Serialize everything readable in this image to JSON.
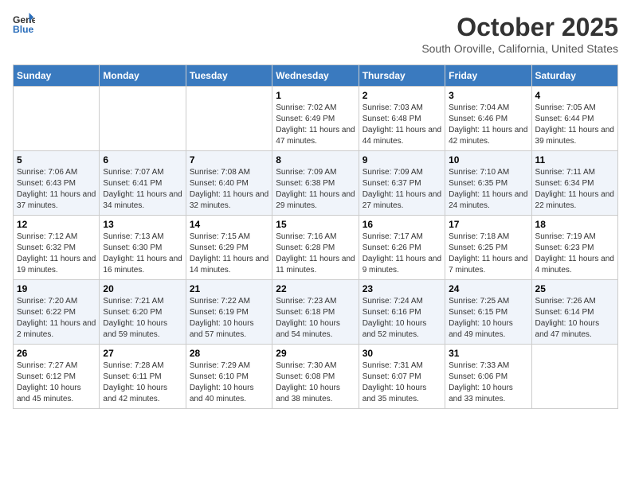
{
  "header": {
    "logo_line1": "General",
    "logo_line2": "Blue",
    "month_title": "October 2025",
    "location": "South Oroville, California, United States"
  },
  "weekdays": [
    "Sunday",
    "Monday",
    "Tuesday",
    "Wednesday",
    "Thursday",
    "Friday",
    "Saturday"
  ],
  "weeks": [
    [
      {
        "day": "",
        "sunrise": "",
        "sunset": "",
        "daylight": ""
      },
      {
        "day": "",
        "sunrise": "",
        "sunset": "",
        "daylight": ""
      },
      {
        "day": "",
        "sunrise": "",
        "sunset": "",
        "daylight": ""
      },
      {
        "day": "1",
        "sunrise": "Sunrise: 7:02 AM",
        "sunset": "Sunset: 6:49 PM",
        "daylight": "Daylight: 11 hours and 47 minutes."
      },
      {
        "day": "2",
        "sunrise": "Sunrise: 7:03 AM",
        "sunset": "Sunset: 6:48 PM",
        "daylight": "Daylight: 11 hours and 44 minutes."
      },
      {
        "day": "3",
        "sunrise": "Sunrise: 7:04 AM",
        "sunset": "Sunset: 6:46 PM",
        "daylight": "Daylight: 11 hours and 42 minutes."
      },
      {
        "day": "4",
        "sunrise": "Sunrise: 7:05 AM",
        "sunset": "Sunset: 6:44 PM",
        "daylight": "Daylight: 11 hours and 39 minutes."
      }
    ],
    [
      {
        "day": "5",
        "sunrise": "Sunrise: 7:06 AM",
        "sunset": "Sunset: 6:43 PM",
        "daylight": "Daylight: 11 hours and 37 minutes."
      },
      {
        "day": "6",
        "sunrise": "Sunrise: 7:07 AM",
        "sunset": "Sunset: 6:41 PM",
        "daylight": "Daylight: 11 hours and 34 minutes."
      },
      {
        "day": "7",
        "sunrise": "Sunrise: 7:08 AM",
        "sunset": "Sunset: 6:40 PM",
        "daylight": "Daylight: 11 hours and 32 minutes."
      },
      {
        "day": "8",
        "sunrise": "Sunrise: 7:09 AM",
        "sunset": "Sunset: 6:38 PM",
        "daylight": "Daylight: 11 hours and 29 minutes."
      },
      {
        "day": "9",
        "sunrise": "Sunrise: 7:09 AM",
        "sunset": "Sunset: 6:37 PM",
        "daylight": "Daylight: 11 hours and 27 minutes."
      },
      {
        "day": "10",
        "sunrise": "Sunrise: 7:10 AM",
        "sunset": "Sunset: 6:35 PM",
        "daylight": "Daylight: 11 hours and 24 minutes."
      },
      {
        "day": "11",
        "sunrise": "Sunrise: 7:11 AM",
        "sunset": "Sunset: 6:34 PM",
        "daylight": "Daylight: 11 hours and 22 minutes."
      }
    ],
    [
      {
        "day": "12",
        "sunrise": "Sunrise: 7:12 AM",
        "sunset": "Sunset: 6:32 PM",
        "daylight": "Daylight: 11 hours and 19 minutes."
      },
      {
        "day": "13",
        "sunrise": "Sunrise: 7:13 AM",
        "sunset": "Sunset: 6:30 PM",
        "daylight": "Daylight: 11 hours and 16 minutes."
      },
      {
        "day": "14",
        "sunrise": "Sunrise: 7:15 AM",
        "sunset": "Sunset: 6:29 PM",
        "daylight": "Daylight: 11 hours and 14 minutes."
      },
      {
        "day": "15",
        "sunrise": "Sunrise: 7:16 AM",
        "sunset": "Sunset: 6:28 PM",
        "daylight": "Daylight: 11 hours and 11 minutes."
      },
      {
        "day": "16",
        "sunrise": "Sunrise: 7:17 AM",
        "sunset": "Sunset: 6:26 PM",
        "daylight": "Daylight: 11 hours and 9 minutes."
      },
      {
        "day": "17",
        "sunrise": "Sunrise: 7:18 AM",
        "sunset": "Sunset: 6:25 PM",
        "daylight": "Daylight: 11 hours and 7 minutes."
      },
      {
        "day": "18",
        "sunrise": "Sunrise: 7:19 AM",
        "sunset": "Sunset: 6:23 PM",
        "daylight": "Daylight: 11 hours and 4 minutes."
      }
    ],
    [
      {
        "day": "19",
        "sunrise": "Sunrise: 7:20 AM",
        "sunset": "Sunset: 6:22 PM",
        "daylight": "Daylight: 11 hours and 2 minutes."
      },
      {
        "day": "20",
        "sunrise": "Sunrise: 7:21 AM",
        "sunset": "Sunset: 6:20 PM",
        "daylight": "Daylight: 10 hours and 59 minutes."
      },
      {
        "day": "21",
        "sunrise": "Sunrise: 7:22 AM",
        "sunset": "Sunset: 6:19 PM",
        "daylight": "Daylight: 10 hours and 57 minutes."
      },
      {
        "day": "22",
        "sunrise": "Sunrise: 7:23 AM",
        "sunset": "Sunset: 6:18 PM",
        "daylight": "Daylight: 10 hours and 54 minutes."
      },
      {
        "day": "23",
        "sunrise": "Sunrise: 7:24 AM",
        "sunset": "Sunset: 6:16 PM",
        "daylight": "Daylight: 10 hours and 52 minutes."
      },
      {
        "day": "24",
        "sunrise": "Sunrise: 7:25 AM",
        "sunset": "Sunset: 6:15 PM",
        "daylight": "Daylight: 10 hours and 49 minutes."
      },
      {
        "day": "25",
        "sunrise": "Sunrise: 7:26 AM",
        "sunset": "Sunset: 6:14 PM",
        "daylight": "Daylight: 10 hours and 47 minutes."
      }
    ],
    [
      {
        "day": "26",
        "sunrise": "Sunrise: 7:27 AM",
        "sunset": "Sunset: 6:12 PM",
        "daylight": "Daylight: 10 hours and 45 minutes."
      },
      {
        "day": "27",
        "sunrise": "Sunrise: 7:28 AM",
        "sunset": "Sunset: 6:11 PM",
        "daylight": "Daylight: 10 hours and 42 minutes."
      },
      {
        "day": "28",
        "sunrise": "Sunrise: 7:29 AM",
        "sunset": "Sunset: 6:10 PM",
        "daylight": "Daylight: 10 hours and 40 minutes."
      },
      {
        "day": "29",
        "sunrise": "Sunrise: 7:30 AM",
        "sunset": "Sunset: 6:08 PM",
        "daylight": "Daylight: 10 hours and 38 minutes."
      },
      {
        "day": "30",
        "sunrise": "Sunrise: 7:31 AM",
        "sunset": "Sunset: 6:07 PM",
        "daylight": "Daylight: 10 hours and 35 minutes."
      },
      {
        "day": "31",
        "sunrise": "Sunrise: 7:33 AM",
        "sunset": "Sunset: 6:06 PM",
        "daylight": "Daylight: 10 hours and 33 minutes."
      },
      {
        "day": "",
        "sunrise": "",
        "sunset": "",
        "daylight": ""
      }
    ]
  ]
}
